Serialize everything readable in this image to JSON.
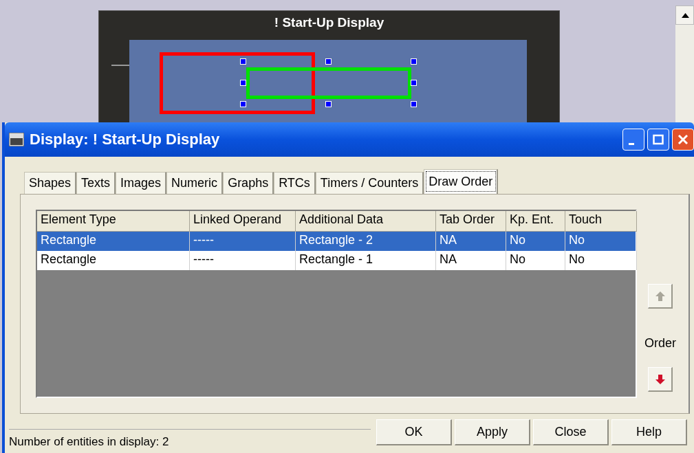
{
  "designer": {
    "title": "! Start-Up Display",
    "shapes": [
      {
        "kind": "rectangle",
        "color": "#ff0000",
        "selected": false
      },
      {
        "kind": "rectangle",
        "color": "#00e000",
        "selected": true
      }
    ]
  },
  "dialog": {
    "title": "Display: ! Start-Up Display",
    "tabs": [
      {
        "label": "Shapes",
        "selected": false
      },
      {
        "label": "Texts",
        "selected": false
      },
      {
        "label": "Images",
        "selected": false
      },
      {
        "label": "Numeric",
        "selected": false
      },
      {
        "label": "Graphs",
        "selected": false
      },
      {
        "label": "RTCs",
        "selected": false
      },
      {
        "label": "Timers / Counters",
        "selected": false
      },
      {
        "label": "Draw Order",
        "selected": true
      }
    ],
    "table": {
      "columns": [
        "Element Type",
        "Linked Operand",
        "Additional Data",
        "Tab Order",
        "Kp. Ent.",
        "Touch"
      ],
      "rows": [
        {
          "selected": true,
          "cells": [
            "Rectangle",
            "-----",
            "Rectangle - 2",
            "NA",
            "No",
            "No"
          ]
        },
        {
          "selected": false,
          "cells": [
            "Rectangle",
            "-----",
            "Rectangle - 1",
            "NA",
            "No",
            "No"
          ]
        }
      ]
    },
    "order": {
      "label": "Order",
      "up": {
        "disabled": true
      },
      "down": {
        "disabled": false
      }
    },
    "status": "Number of entities in display: 2",
    "buttons": [
      "OK",
      "Apply",
      "Close",
      "Help"
    ]
  }
}
